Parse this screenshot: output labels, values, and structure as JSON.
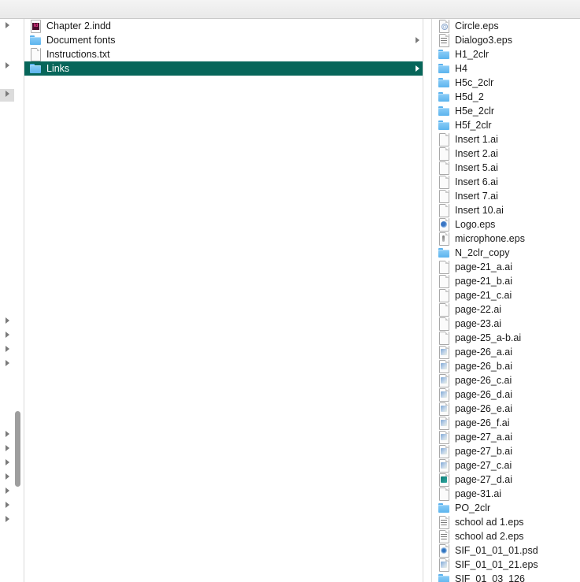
{
  "column1": {
    "items": [
      {
        "label": "Chapter 2.indd",
        "icon": "indesign-document-icon",
        "folder": false,
        "selected": false
      },
      {
        "label": "Document fonts",
        "icon": "folder-icon",
        "folder": true,
        "selected": false
      },
      {
        "label": "Instructions.txt",
        "icon": "text-document-icon",
        "folder": false,
        "selected": false
      },
      {
        "label": "Links",
        "icon": "folder-icon",
        "folder": true,
        "selected": true
      }
    ]
  },
  "column2": {
    "items": [
      {
        "label": "Circle.eps",
        "icon": "eps-document-icon"
      },
      {
        "label": "Dialogo3.eps",
        "icon": "eps-document-icon"
      },
      {
        "label": "H1_2clr",
        "icon": "folder-icon"
      },
      {
        "label": "H4",
        "icon": "folder-icon"
      },
      {
        "label": "H5c_2clr",
        "icon": "folder-icon"
      },
      {
        "label": "H5d_2",
        "icon": "folder-icon"
      },
      {
        "label": "H5e_2clr",
        "icon": "folder-icon"
      },
      {
        "label": "H5f_2clr",
        "icon": "folder-icon"
      },
      {
        "label": "Insert 1.ai",
        "icon": "illustrator-document-icon"
      },
      {
        "label": "Insert 2.ai",
        "icon": "illustrator-document-icon"
      },
      {
        "label": "Insert 5.ai",
        "icon": "illustrator-document-icon"
      },
      {
        "label": "Insert 6.ai",
        "icon": "illustrator-document-icon"
      },
      {
        "label": "Insert 7.ai",
        "icon": "illustrator-document-icon"
      },
      {
        "label": "Insert 10.ai",
        "icon": "illustrator-document-icon"
      },
      {
        "label": "Logo.eps",
        "icon": "eps-logo-document-icon"
      },
      {
        "label": "microphone.eps",
        "icon": "eps-microphone-document-icon"
      },
      {
        "label": "N_2clr_copy",
        "icon": "folder-icon"
      },
      {
        "label": "page-21_a.ai",
        "icon": "illustrator-document-icon"
      },
      {
        "label": "page-21_b.ai",
        "icon": "illustrator-document-icon"
      },
      {
        "label": "page-21_c.ai",
        "icon": "illustrator-document-icon"
      },
      {
        "label": "page-22.ai",
        "icon": "illustrator-document-icon"
      },
      {
        "label": "page-23.ai",
        "icon": "illustrator-document-icon"
      },
      {
        "label": "page-25_a-b.ai",
        "icon": "illustrator-document-icon"
      },
      {
        "label": "page-26_a.ai",
        "icon": "image-document-icon"
      },
      {
        "label": "page-26_b.ai",
        "icon": "image-document-icon"
      },
      {
        "label": "page-26_c.ai",
        "icon": "image-document-icon"
      },
      {
        "label": "page-26_d.ai",
        "icon": "image-document-icon"
      },
      {
        "label": "page-26_e.ai",
        "icon": "image-document-icon"
      },
      {
        "label": "page-26_f.ai",
        "icon": "image-document-icon"
      },
      {
        "label": "page-27_a.ai",
        "icon": "image-document-icon"
      },
      {
        "label": "page-27_b.ai",
        "icon": "image-document-icon"
      },
      {
        "label": "page-27_c.ai",
        "icon": "image-document-icon"
      },
      {
        "label": "page-27_d.ai",
        "icon": "teal-image-document-icon"
      },
      {
        "label": "page-31.ai",
        "icon": "illustrator-document-icon"
      },
      {
        "label": "PO_2clr",
        "icon": "folder-icon"
      },
      {
        "label": "school ad 1.eps",
        "icon": "text-preview-document-icon"
      },
      {
        "label": "school ad 2.eps",
        "icon": "text-preview-document-icon"
      },
      {
        "label": "SIF_01_01_01.psd",
        "icon": "photoshop-document-icon"
      },
      {
        "label": "SIF_01_01_21.eps",
        "icon": "image-document-icon"
      },
      {
        "label": "SIF_01_03_126",
        "icon": "folder-icon"
      }
    ]
  }
}
